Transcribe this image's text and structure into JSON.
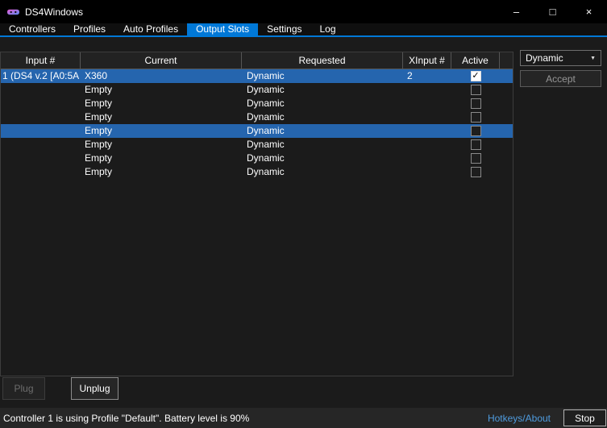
{
  "colors": {
    "accent": "#0078d7",
    "selection_blue": "#2565ae",
    "link_blue": "#4f9cdf"
  },
  "glyphs": {
    "check": "✓",
    "dropdown_arrow": "▼",
    "minimize": "–",
    "maximize": "□",
    "close": "×"
  },
  "window": {
    "title": "DS4Windows"
  },
  "tabs": [
    {
      "label": "Controllers",
      "active": false
    },
    {
      "label": "Profiles",
      "active": false
    },
    {
      "label": "Auto Profiles",
      "active": false
    },
    {
      "label": "Output Slots",
      "active": true
    },
    {
      "label": "Settings",
      "active": false
    },
    {
      "label": "Log",
      "active": false
    }
  ],
  "table": {
    "headers": [
      "Input #",
      "Current",
      "Requested",
      "XInput #",
      "Active"
    ],
    "rows": [
      {
        "input_id": "1 (DS4 v.2 [A0:5A",
        "current": "X360",
        "requested": "Dynamic",
        "xinput": "2",
        "active": true,
        "selected": true
      },
      {
        "input_id": "",
        "current": "Empty",
        "requested": "Dynamic",
        "xinput": "",
        "active": false,
        "selected": false
      },
      {
        "input_id": "",
        "current": "Empty",
        "requested": "Dynamic",
        "xinput": "",
        "active": false,
        "selected": false
      },
      {
        "input_id": "",
        "current": "Empty",
        "requested": "Dynamic",
        "xinput": "",
        "active": false,
        "selected": false
      },
      {
        "input_id": "",
        "current": "Empty",
        "requested": "Dynamic",
        "xinput": "",
        "active": false,
        "selected": true
      },
      {
        "input_id": "",
        "current": "Empty",
        "requested": "Dynamic",
        "xinput": "",
        "active": false,
        "selected": false
      },
      {
        "input_id": "",
        "current": "Empty",
        "requested": "Dynamic",
        "xinput": "",
        "active": false,
        "selected": false
      },
      {
        "input_id": "",
        "current": "Empty",
        "requested": "Dynamic",
        "xinput": "",
        "active": false,
        "selected": false
      }
    ]
  },
  "side_panel": {
    "dropdown_value": "Dynamic",
    "accept_label": "Accept"
  },
  "footer": {
    "plug_label": "Plug",
    "unplug_label": "Unplug"
  },
  "status": {
    "message": "Controller 1 is using Profile \"Default\". Battery level is 90%",
    "link_label": "Hotkeys/About",
    "stop_label": "Stop"
  }
}
